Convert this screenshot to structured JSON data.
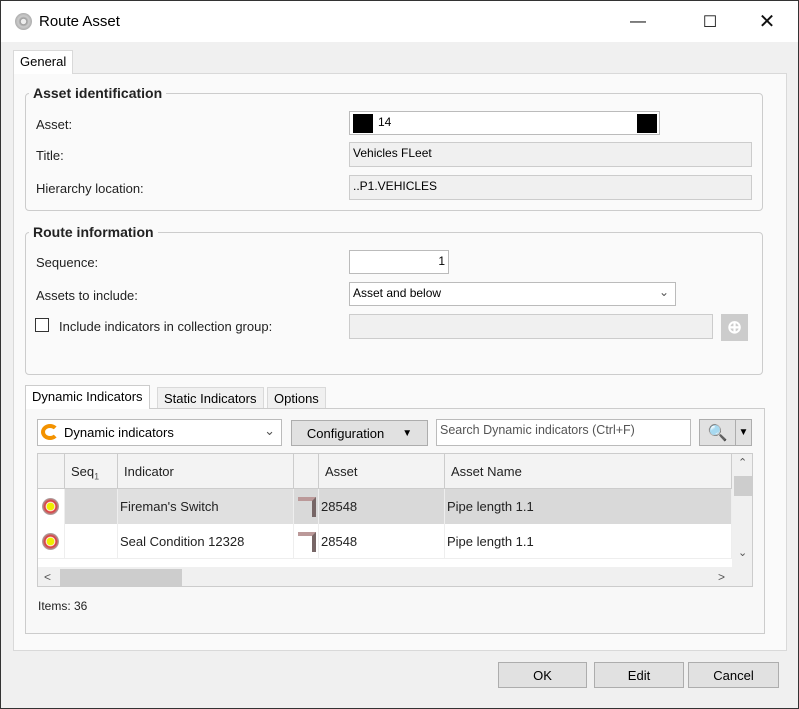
{
  "window": {
    "title": "Route Asset"
  },
  "tabs": {
    "general": "General"
  },
  "asset_identification": {
    "title": "Asset identification",
    "asset_label": "Asset:",
    "asset_value": "14",
    "title_label": "Title:",
    "title_value": "Vehicles FLeet",
    "hierarchy_label": "Hierarchy location:",
    "hierarchy_value": "..P1.VEHICLES"
  },
  "route_information": {
    "title": "Route information",
    "sequence_label": "Sequence:",
    "sequence_value": "1",
    "assets_label": "Assets to include:",
    "assets_value": "Asset and below",
    "include_label": "Include indicators in collection group:",
    "include_checked": false,
    "collection_value": ""
  },
  "inner_tabs": [
    "Dynamic Indicators",
    "Static Indicators",
    "Options"
  ],
  "toolbar": {
    "filter_value": "Dynamic indicators",
    "configuration": "Configuration",
    "search_placeholder": "Search Dynamic indicators  (Ctrl+F)"
  },
  "grid": {
    "columns": [
      "",
      "Seq",
      "Indicator",
      "",
      "Asset",
      "Asset Name"
    ],
    "sort_marker": "1",
    "rows": [
      {
        "seq": "",
        "indicator": "Fireman's Switch",
        "asset": "28548",
        "asset_name": "Pipe length 1.1",
        "selected": true
      },
      {
        "seq": "",
        "indicator": "Seal Condition 12328",
        "asset": "28548",
        "asset_name": "Pipe length 1.1",
        "selected": false
      }
    ]
  },
  "items_count": "Items: 36",
  "buttons": {
    "ok": "OK",
    "edit": "Edit",
    "cancel": "Cancel"
  }
}
